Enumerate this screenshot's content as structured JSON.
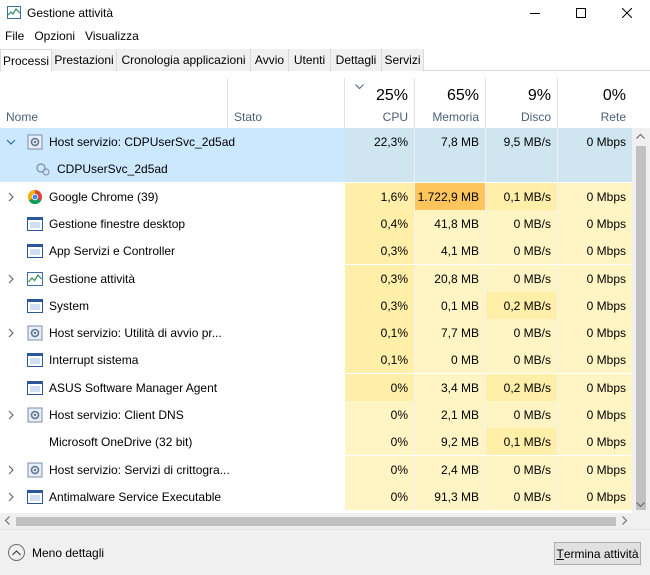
{
  "window": {
    "title": "Gestione attività",
    "controls": [
      "minimize-icon",
      "maximize-icon",
      "close-icon"
    ]
  },
  "menu": [
    "File",
    "Opzioni",
    "Visualizza"
  ],
  "tabs": [
    {
      "label": "Processi",
      "active": true
    },
    {
      "label": "Prestazioni",
      "active": false
    },
    {
      "label": "Cronologia applicazioni",
      "active": false
    },
    {
      "label": "Avvio",
      "active": false
    },
    {
      "label": "Utenti",
      "active": false
    },
    {
      "label": "Dettagli",
      "active": false
    },
    {
      "label": "Servizi",
      "active": false
    }
  ],
  "columns": {
    "name": "Nome",
    "status": "Stato",
    "cpu": {
      "pct": "25%",
      "label": "CPU"
    },
    "memory": {
      "pct": "65%",
      "label": "Memoria"
    },
    "disk": {
      "pct": "9%",
      "label": "Disco"
    },
    "network": {
      "pct": "0%",
      "label": "Rete"
    }
  },
  "processes": [
    {
      "name": "Host servizio: CDPUserSvc_2d5ad",
      "icon": "gear-icon",
      "expander": "expanded",
      "state": "selected",
      "cpu": "22,3%",
      "mem": "7,8 MB",
      "disk": "9,5 MB/s",
      "net": "0 Mbps"
    },
    {
      "name": "CDPUserSvc_2d5ad",
      "icon": "service-icon",
      "expander": "none",
      "state": "selected-child",
      "child": true,
      "cpu": "",
      "mem": "",
      "disk": "",
      "net": ""
    },
    {
      "name": "Google Chrome (39)",
      "icon": "chrome-icon",
      "expander": "collapsed",
      "cpu": "1,6%",
      "mem": "1.722,9 MB",
      "disk": "0,1 MB/s",
      "net": "0 Mbps",
      "mem_hot": true
    },
    {
      "name": "Gestione finestre desktop",
      "icon": "window-icon",
      "expander": "none",
      "cpu": "0,4%",
      "mem": "41,8 MB",
      "disk": "0 MB/s",
      "net": "0 Mbps"
    },
    {
      "name": "App Servizi e Controller",
      "icon": "window-icon",
      "expander": "none",
      "cpu": "0,3%",
      "mem": "4,1 MB",
      "disk": "0 MB/s",
      "net": "0 Mbps"
    },
    {
      "name": "Gestione attività",
      "icon": "taskmgr-icon",
      "expander": "collapsed",
      "cpu": "0,3%",
      "mem": "20,8 MB",
      "disk": "0 MB/s",
      "net": "0 Mbps"
    },
    {
      "name": "System",
      "icon": "window-icon",
      "expander": "none",
      "cpu": "0,3%",
      "mem": "0,1 MB",
      "disk": "0,2 MB/s",
      "net": "0 Mbps"
    },
    {
      "name": "Host servizio: Utilità di avvio pr...",
      "icon": "gear-icon",
      "expander": "collapsed",
      "cpu": "0,1%",
      "mem": "7,7 MB",
      "disk": "0 MB/s",
      "net": "0 Mbps"
    },
    {
      "name": "Interrupt sistema",
      "icon": "window-icon",
      "expander": "none",
      "cpu": "0,1%",
      "mem": "0 MB",
      "disk": "0 MB/s",
      "net": "0 Mbps"
    },
    {
      "name": "ASUS Software Manager Agent",
      "icon": "window-icon",
      "expander": "none",
      "cpu": "0%",
      "mem": "3,4 MB",
      "disk": "0,2 MB/s",
      "net": "0 Mbps"
    },
    {
      "name": "Host servizio: Client DNS",
      "icon": "gear-icon",
      "expander": "collapsed",
      "cpu": "0%",
      "mem": "2,1 MB",
      "disk": "0 MB/s",
      "net": "0 Mbps"
    },
    {
      "name": "Microsoft OneDrive (32 bit)",
      "icon": "none",
      "expander": "none",
      "cpu": "0%",
      "mem": "9,2 MB",
      "disk": "0,1 MB/s",
      "net": "0 Mbps"
    },
    {
      "name": "Host servizio: Servizi di crittogra...",
      "icon": "gear-icon",
      "expander": "collapsed",
      "cpu": "0%",
      "mem": "2,4 MB",
      "disk": "0 MB/s",
      "net": "0 Mbps"
    },
    {
      "name": "Antimalware Service Executable",
      "icon": "window-icon",
      "expander": "collapsed",
      "cpu": "0%",
      "mem": "91,3 MB",
      "disk": "0 MB/s",
      "net": "0 Mbps"
    }
  ],
  "colors": {
    "selected": "#cce8ff",
    "selected_data": "#cfe6f0",
    "heat_light": "#fff4c4",
    "heat_mid": "#ffefa8",
    "heat_hot": "#ffc55c",
    "header_label": "#4a5f77"
  },
  "footer": {
    "less_details": "Meno dettagli",
    "end_task_first": "T",
    "end_task_rest": "ermina attività"
  }
}
